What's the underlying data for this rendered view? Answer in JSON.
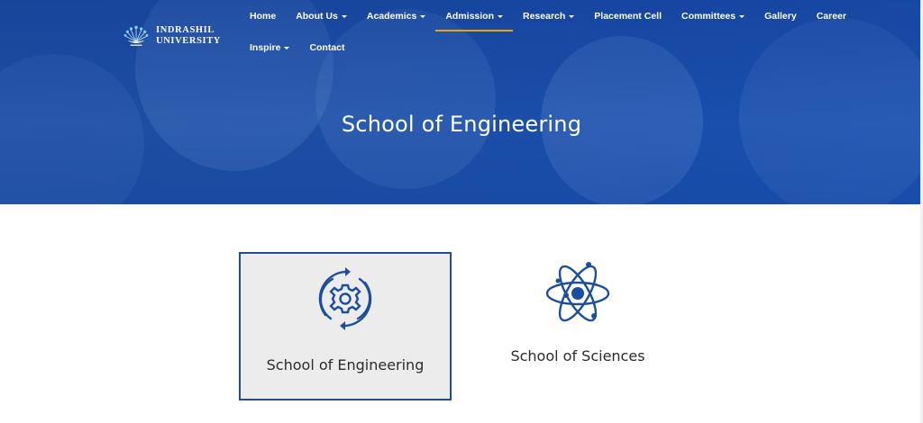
{
  "brand": {
    "line1": "Indrashil",
    "line2": "University",
    "logo_icon": "peacock-logo-icon",
    "accent": "#f0a500",
    "primary": "#1d4e9e"
  },
  "nav": {
    "row1": [
      {
        "label": "Home",
        "dropdown": false
      },
      {
        "label": "About Us",
        "dropdown": true
      },
      {
        "label": "Academics",
        "dropdown": true
      },
      {
        "label": "Admission",
        "dropdown": true,
        "active": true
      },
      {
        "label": "Research",
        "dropdown": true
      },
      {
        "label": "Placement Cell",
        "dropdown": false
      },
      {
        "label": "Committees",
        "dropdown": true
      },
      {
        "label": "Gallery",
        "dropdown": false
      },
      {
        "label": "Career",
        "dropdown": false
      }
    ],
    "row2": [
      {
        "label": "Inspire",
        "dropdown": true
      },
      {
        "label": "Contact",
        "dropdown": false
      }
    ]
  },
  "hero": {
    "title": "School of Engineering"
  },
  "schools": [
    {
      "label": "School of Engineering",
      "icon": "gear-cycle-icon",
      "selected": true
    },
    {
      "label": "School of Sciences",
      "icon": "atom-icon",
      "selected": false
    }
  ]
}
